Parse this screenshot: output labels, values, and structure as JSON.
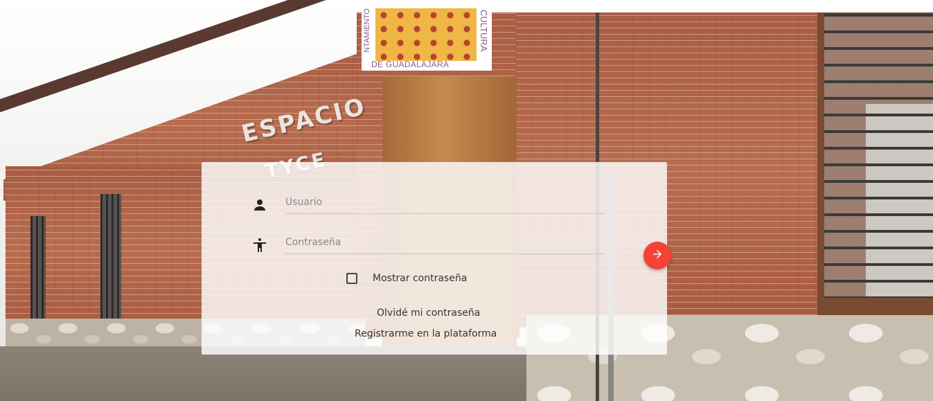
{
  "logo": {
    "left_text": "NTAMIENTO",
    "bottom_text": "DE GUADALAJARA",
    "right_text": "CULTURA"
  },
  "building_sign": {
    "line1": "ESPACIO",
    "line2": "TYCE"
  },
  "login": {
    "username_placeholder": "Usuario",
    "password_placeholder": "Contraseña",
    "show_password_label": "Mostrar contraseña",
    "forgot_password_link": "Olvidé mi contraseña",
    "register_link": "Registrarme en la plataforma",
    "submit_icon": "arrow-right-icon",
    "submit_color": "#f44336"
  },
  "icons": {
    "username": "person-icon",
    "password": "accessibility-icon",
    "checkbox": "checkbox-unchecked-icon"
  }
}
